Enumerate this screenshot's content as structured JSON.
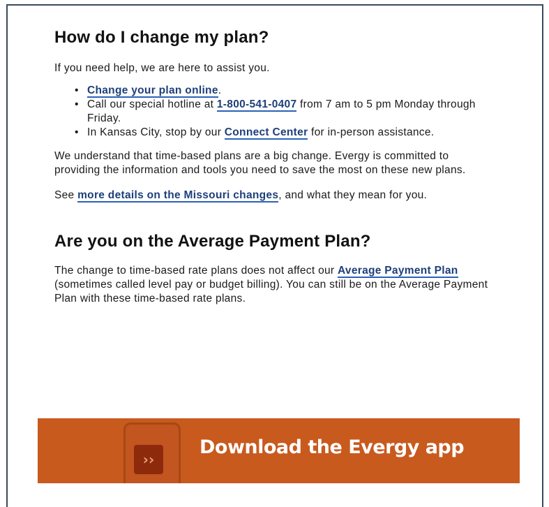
{
  "section1": {
    "heading": "How do I change my plan?",
    "intro": "If you need help, we are here to assist you.",
    "item1_link": "Change your plan online",
    "item1_after": ".",
    "item2_before": "Call our special hotline at ",
    "item2_link": "1-800-541-0407",
    "item2_after": " from 7 am to 5 pm Monday through Friday.",
    "item3_before": "In Kansas City, stop by our ",
    "item3_link": "Connect Center",
    "item3_after": " for in-person assistance.",
    "para": "We understand that time-based plans are a big change. Evergy is committed to providing the information and tools you need to save the most on these new plans.",
    "see_before": "See ",
    "see_link": "more details on the Missouri changes",
    "see_after": ", and what they mean for you."
  },
  "section2": {
    "heading": "Are you on the Average Payment Plan?",
    "para_before": "The change to time-based rate plans does not affect our ",
    "para_link": "Average Payment Plan",
    "para_after": " (sometimes called level pay or budget billing). You can still be on the Average Payment Plan with these time-based rate plans."
  },
  "banner": {
    "label": "Download the Evergy app",
    "icon": "evergy-app-icon",
    "icon_glyph": "››",
    "color": "#c85a1e"
  },
  "bullet": "•"
}
